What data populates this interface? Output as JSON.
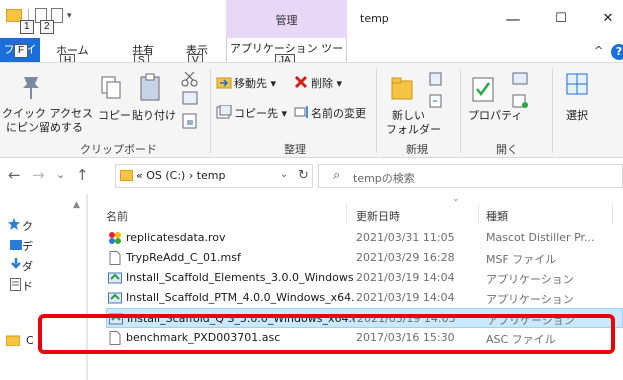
{
  "titlebar": {
    "contextual_tab_group": "管理",
    "window_title": "temp",
    "minimize_glyph": "—",
    "maximize_glyph": "☐",
    "close_glyph": "✕",
    "qat_keytips": [
      "1",
      "2"
    ]
  },
  "tabs": {
    "file": "ファイル",
    "file_keytip": "F",
    "home": "ホーム",
    "home_keytip": "H",
    "share": "共有",
    "share_keytip": "S",
    "view": "表示",
    "view_keytip": "V",
    "app_tools": "アプリケーション ツール",
    "app_tools_keytip": "JA",
    "help_glyph": "?",
    "collapse_glyph": "^"
  },
  "ribbon": {
    "clipboard": {
      "pin_line1": "クイック アクセス",
      "pin_line2": "にピン留めする",
      "copy": "コピー",
      "paste": "貼り付け",
      "label": "クリップボード"
    },
    "organize": {
      "move_to": "移動先",
      "delete": "削除",
      "copy_to": "コピー先",
      "rename": "名前の変更",
      "label": "整理"
    },
    "new": {
      "new_folder_line1": "新しい",
      "new_folder_line2": "フォルダー",
      "label": "新規"
    },
    "open": {
      "properties": "プロパティ",
      "label": "開く"
    },
    "select": {
      "select": "選択"
    }
  },
  "address": {
    "back": "←",
    "forward": "→",
    "recent": "⌄",
    "up": "↑",
    "path": "« OS (C:) › temp",
    "search_placeholder": "tempの検索"
  },
  "navpane": {
    "items": [
      "ク",
      "デ",
      "ダ",
      "ド",
      "C"
    ]
  },
  "filelist": {
    "columns": {
      "name": "名前",
      "date": "更新日時",
      "type": "種類"
    },
    "rows": [
      {
        "name": "replicatesdata.rov",
        "date": "2021/03/31 11:05",
        "type": "Mascot Distiller Pr...",
        "icon": "mascot-icon",
        "selected": false
      },
      {
        "name": "TrypReAdd_C_01.msf",
        "date": "2021/03/29 16:28",
        "type": "MSF ファイル",
        "icon": "document-icon",
        "selected": false
      },
      {
        "name": "Install_Scaffold_Elements_3.0.0_Windows...",
        "date": "2021/03/19 14:04",
        "type": "アプリケーション",
        "icon": "installer-icon",
        "selected": false
      },
      {
        "name": "Install_Scaffold_PTM_4.0.0_Windows_x64....",
        "date": "2021/03/19 14:04",
        "type": "アプリケーション",
        "icon": "installer-icon",
        "selected": false
      },
      {
        "name": "Install_Scaffold_Q S_5.0.0_Windows_x64.e...",
        "date": "2021/03/19 14:03",
        "type": "アプリケーション",
        "icon": "installer-icon",
        "selected": true
      },
      {
        "name": "benchmark_PXD003701.asc",
        "date": "2017/03/16 15:30",
        "type": "ASC ファイル",
        "icon": "document-icon",
        "selected": false
      }
    ]
  },
  "colors": {
    "accent": "#1a6ed8",
    "contextual_band": "#e8d7f6",
    "selection": "#cce8ff",
    "highlight": "#e8000b"
  }
}
